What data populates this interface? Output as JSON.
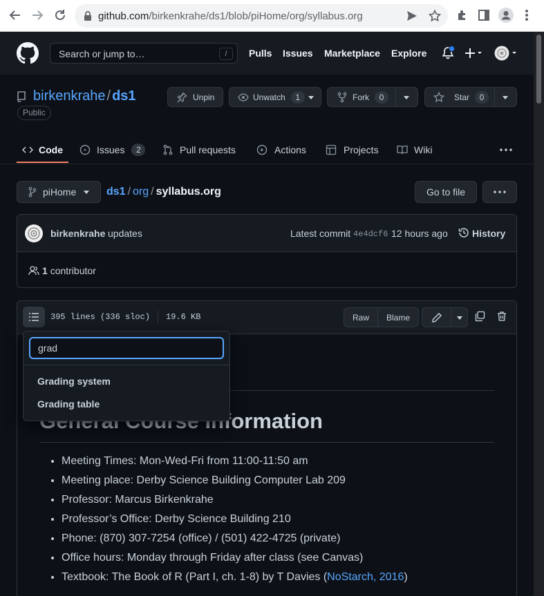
{
  "browser": {
    "url_host": "github.com",
    "url_path": "/birkenkrahe/ds1/blob/piHome/org/syllabus.org"
  },
  "header": {
    "search_placeholder": "Search or jump to…",
    "search_shortcut": "/",
    "nav": [
      "Pulls",
      "Issues",
      "Marketplace",
      "Explore"
    ]
  },
  "repo": {
    "owner": "birkenkrahe",
    "separator": "/",
    "name": "ds1",
    "visibility": "Public",
    "unpin_label": "Unpin",
    "unwatch_label": "Unwatch",
    "unwatch_count": "1",
    "fork_label": "Fork",
    "fork_count": "0",
    "star_label": "Star",
    "star_count": "0"
  },
  "tabs": {
    "code": "Code",
    "issues": "Issues",
    "issues_count": "2",
    "pulls": "Pull requests",
    "actions": "Actions",
    "projects": "Projects",
    "wiki": "Wiki"
  },
  "file_nav": {
    "branch": "piHome",
    "path_root": "ds1",
    "path_dir": "org",
    "path_file": "syllabus.org",
    "goto_label": "Go to file",
    "more_label": "···"
  },
  "commit": {
    "author": "birkenkrahe",
    "message": "updates",
    "latest_label": "Latest commit",
    "hash": "4e4dcf6",
    "time": "12 hours ago",
    "history_label": "History",
    "contributors_count": "1",
    "contributors_label": "contributor"
  },
  "file_header": {
    "lines": "395 lines (336 sloc)",
    "size": "19.6 KB",
    "raw_label": "Raw",
    "blame_label": "Blame"
  },
  "outline_dropdown": {
    "query": "grad",
    "options": [
      "Grading system",
      "Grading table"
    ]
  },
  "content": {
    "heading": "General Course Information",
    "items": [
      "Meeting Times: Mon-Wed-Fri from 11:00-11:50 am",
      "Meeting place: Derby Science Building Computer Lab 209",
      "Professor: Marcus Birkenkrahe",
      "Professor’s Office: Derby Science Building 210",
      "Phone: (870) 307-7254 (office) / (501) 422-4725 (private)",
      "Office hours: Monday through Friday after class (see Canvas)"
    ],
    "textbook_prefix": "Textbook: The Book of R (Part I, ch. 1-8) by T Davies (",
    "textbook_link": "NoStarch, 2016",
    "textbook_suffix": ")"
  },
  "colors": {
    "background": "#0d1117",
    "header": "#161b22",
    "link": "#58a6ff",
    "tab_underline": "#f78166",
    "notification_dot": "#2f81f7"
  }
}
